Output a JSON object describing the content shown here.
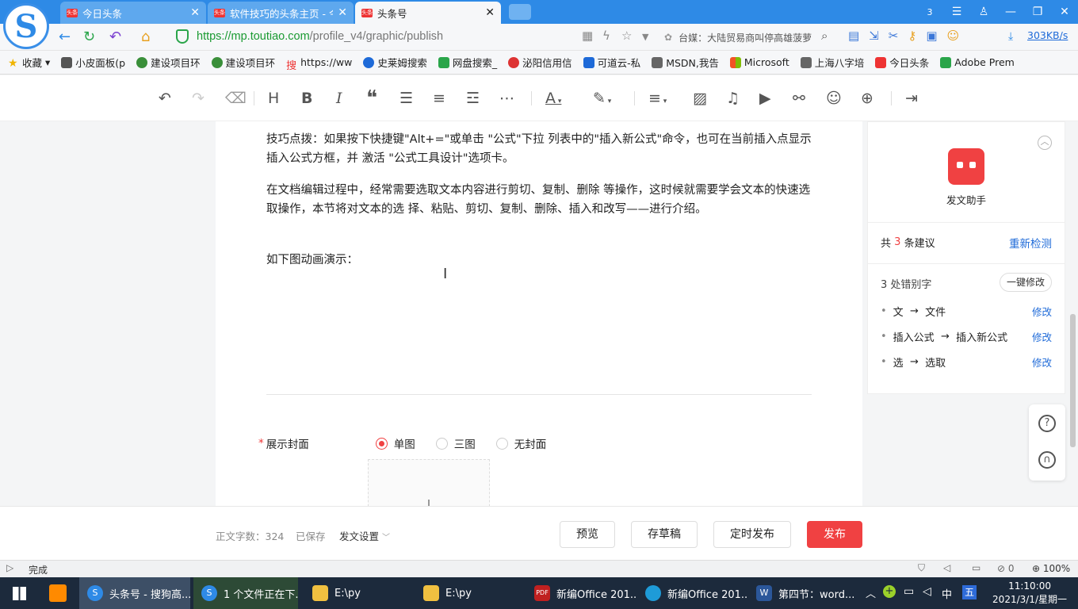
{
  "browser": {
    "tabs": [
      {
        "label": "今日头条",
        "active": false
      },
      {
        "label": "软件技巧的头条主页 - 今",
        "active": false
      },
      {
        "label": "头条号",
        "active": true
      }
    ],
    "url_host": "https://mp.toutiao.com",
    "url_path": "/profile_v4/graphic/publish",
    "search_text": "台媒：大陆贸易商叫停高雄菠萝",
    "speed": "303KB/s",
    "tab_count": "3"
  },
  "bookmarks": [
    "收藏",
    "小皮面板(p",
    "建设项目环",
    "建设项目环",
    "https://ww",
    "史莱姆搜索",
    "网盘搜索_",
    "泌阳信用信",
    "可道云-私",
    "MSDN,我告",
    "Microsoft",
    "上海八字培",
    "今日头条",
    "Adobe Prem"
  ],
  "article": {
    "p1": "技巧点拨：如果按下快捷键\"Alt+=\"或单击 \"公式\"下拉 列表中的\"插入新公式\"命令，也可在当前插入点显示插入公式方框，并 激活 \"公式工具设计\"选项卡。",
    "p2": "在文档编辑过程中，经常需要选取文本内容进行剪切、复制、删除 等操作，这时候就需要学会文本的快速选取操作，本节将对文本的选 择、粘贴、剪切、复制、删除、插入和改写——进行介绍。",
    "p3": "如下图动画演示："
  },
  "cover": {
    "label": "展示封面",
    "options": [
      "单图",
      "三图",
      "无封面"
    ],
    "selected": "单图"
  },
  "assistant": {
    "title": "发文助手",
    "summary_prefix": "共",
    "summary_count": "3",
    "summary_suffix": "条建议",
    "recheck": "重新检测",
    "typo_header": "3 处错别字",
    "fix_all": "一键修改",
    "items": [
      {
        "from": "文",
        "to": "文件",
        "action": "修改"
      },
      {
        "from": "插入公式",
        "to": "插入新公式",
        "action": "修改"
      },
      {
        "from": "选",
        "to": "选取",
        "action": "修改"
      }
    ]
  },
  "footer": {
    "word_count": "正文字数：324",
    "saved": "已保存",
    "settings": "发文设置",
    "preview": "预览",
    "draft": "存草稿",
    "schedule": "定时发布",
    "publish": "发布"
  },
  "status": {
    "left": "完成",
    "badge": "0",
    "zoom": "100%"
  },
  "taskbar": {
    "items": [
      "头条号 - 搜狗高...",
      "1 个文件正在下...",
      "E:\\py",
      "E:\\py",
      "新编Office 201...",
      "新编Office 201...",
      "第四节：word..."
    ],
    "ime1": "中",
    "ime2": "五",
    "time": "11:10:00",
    "date": "2021/3/1/星期一"
  },
  "colors": {
    "accent": "#f04142",
    "link": "#1e6ad8",
    "chrome": "#2e8ae6"
  }
}
